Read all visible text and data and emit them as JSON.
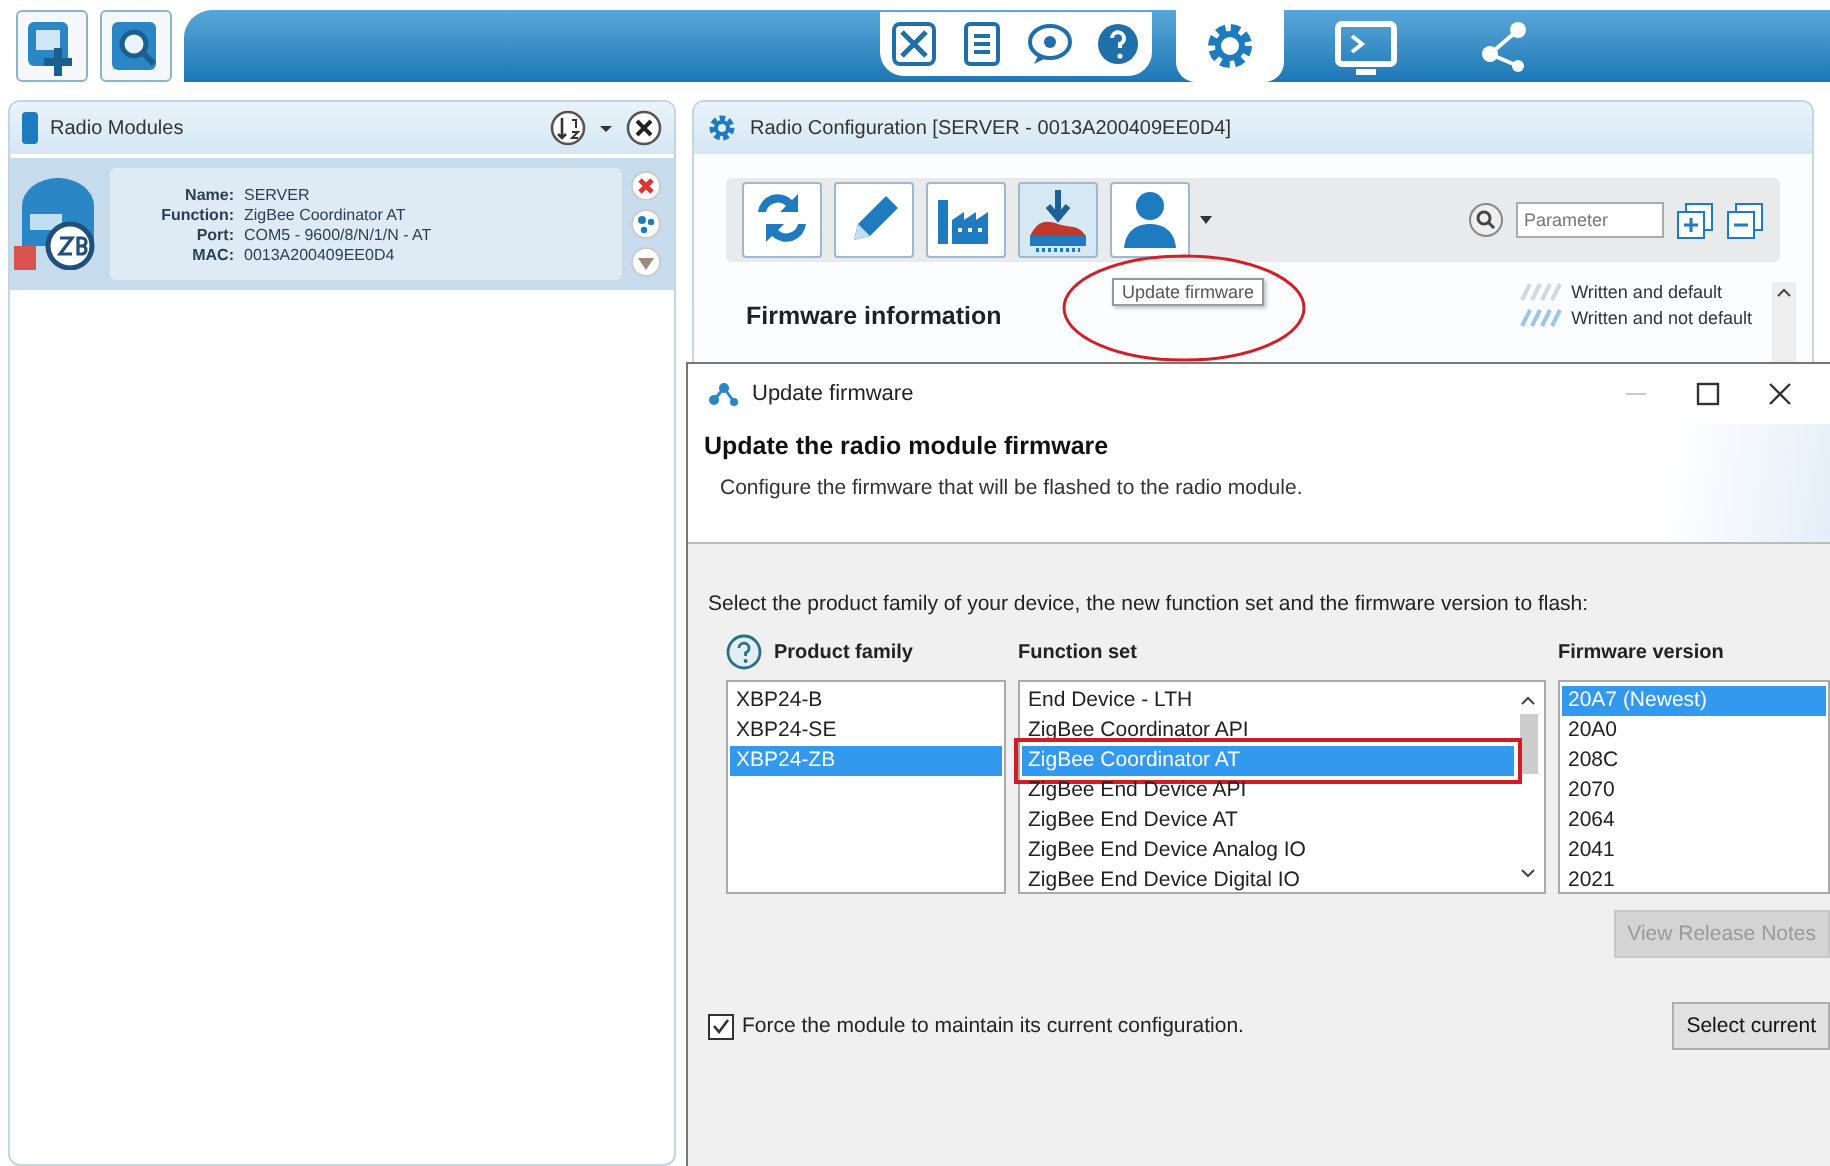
{
  "radio_modules": {
    "title": "Radio Modules",
    "modules": [
      {
        "fields": [
          {
            "label": "Name:",
            "value": "SERVER"
          },
          {
            "label": "Function:",
            "value": "ZigBee Coordinator AT"
          },
          {
            "label": "Port:",
            "value": "COM5 - 9600/8/N/1/N - AT"
          },
          {
            "label": "MAC:",
            "value": "0013A200409EE0D4"
          }
        ]
      }
    ]
  },
  "radio_configuration": {
    "title": "Radio Configuration [SERVER - 0013A200409EE0D4]",
    "search": {
      "placeholder": "Parameter"
    },
    "tooltip": "Update firmware",
    "section_title": "Firmware information",
    "legend": [
      "Written and default",
      "Written and not default"
    ]
  },
  "dialog": {
    "title": "Update firmware",
    "heading": "Update the radio module firmware",
    "description": "Configure the firmware that will be flashed to the radio module.",
    "instruction": "Select the product family of your device, the new function set and the firmware version to flash:",
    "lists": [
      {
        "header": "Product family",
        "items": [
          {
            "label": "XBP24-B",
            "selected": false
          },
          {
            "label": "XBP24-SE",
            "selected": false
          },
          {
            "label": "XBP24-ZB",
            "selected": true
          }
        ]
      },
      {
        "header": "Function set",
        "items": [
          {
            "label": "End Device - LTH",
            "selected": false
          },
          {
            "label": "ZigBee Coordinator API",
            "selected": false
          },
          {
            "label": "ZigBee Coordinator AT",
            "selected": true
          },
          {
            "label": "ZigBee End Device API",
            "selected": false
          },
          {
            "label": "ZigBee End Device AT",
            "selected": false
          },
          {
            "label": "ZigBee End Device Analog IO",
            "selected": false
          },
          {
            "label": "ZigBee End Device Digital IO",
            "selected": false
          }
        ]
      },
      {
        "header": "Firmware version",
        "items": [
          {
            "label": "20A7 (Newest)",
            "selected": true
          },
          {
            "label": "20A0",
            "selected": false
          },
          {
            "label": "208C",
            "selected": false
          },
          {
            "label": "2070",
            "selected": false
          },
          {
            "label": "2064",
            "selected": false
          },
          {
            "label": "2041",
            "selected": false
          },
          {
            "label": "2021",
            "selected": false
          }
        ]
      }
    ],
    "release_notes_button": {
      "label": "View Release Notes",
      "disabled": true
    },
    "force_checkbox": {
      "label": "Force the module to maintain its current configuration.",
      "checked": true
    },
    "select_current_button": {
      "label": "Select current"
    }
  }
}
